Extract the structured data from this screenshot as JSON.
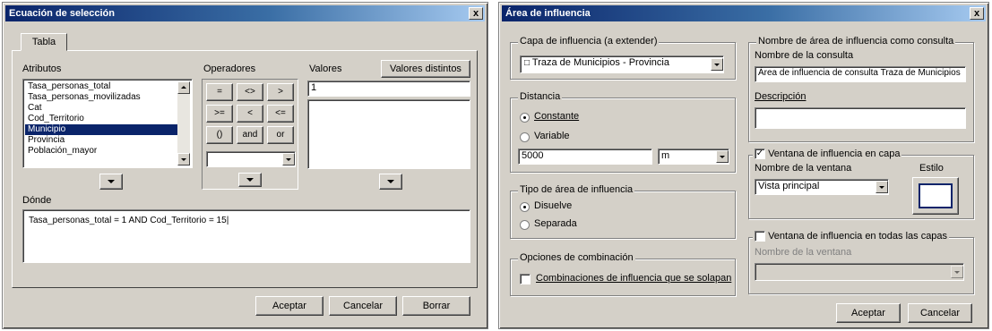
{
  "left_dialog": {
    "title": "Ecuación de selección",
    "close": "x",
    "tab": "Tabla",
    "attributes_label": "Atributos",
    "attributes": [
      "Tasa_personas_total",
      "Tasa_personas_movilizadas",
      "Cat",
      "Cod_Territorio",
      "Municipio",
      "Provincia",
      "Población_mayor"
    ],
    "attributes_selected_index": 4,
    "operators_label": "Operadores",
    "operators": [
      "=",
      "<>",
      ">",
      ">=",
      "<",
      "<=",
      "()",
      "and",
      "or"
    ],
    "values_label": "Valores",
    "values_button": "Valores distintos",
    "values_input": "1",
    "value_items": [],
    "where_label": "Dónde",
    "where_text": "Tasa_personas_total = 1 AND Cod_Territorio = 15",
    "buttons": [
      "Aceptar",
      "Cancelar",
      "Borrar"
    ]
  },
  "right_dialog": {
    "title": "Área de influencia",
    "close": "x",
    "layer_group": "Capa de influencia (a extender)",
    "layer_value": "Traza de Municipios - Provincia",
    "distance_group": "Distancia",
    "distance_options": [
      "Constante",
      "Variable"
    ],
    "distance_selected": 0,
    "distance_value": "5000",
    "distance_unit": "m",
    "region_group": "Tipo de área de influencia",
    "region_options": [
      "Disuelve",
      "Separada"
    ],
    "region_selected": 0,
    "options_group": "Opciones de combinación",
    "options_check": "Combinaciones de influencia que se solapan",
    "query_group": "Nombre de área de influencia como consulta",
    "query_name_label": "Nombre de la consulta",
    "query_name_value": "Área de influencia de consulta Traza de Municipios",
    "description_label": "Descripción",
    "description_value": "",
    "window_check": "Ventana de influencia en capa",
    "window_check_state": "checked",
    "window_name_label": "Nombre de la ventana",
    "window_name_value": "Vista principal",
    "style_label": "Estilo",
    "other_check": "Ventana de influencia en todas las capas",
    "other_name_label": "Nombre de la ventana",
    "other_name_value": "",
    "buttons": [
      "Aceptar",
      "Cancelar"
    ]
  },
  "colors": {
    "titlebar_start": "#0a246a",
    "titlebar_end": "#a6caf0",
    "dialog_bg": "#d4d0c8",
    "selection": "#0a246a"
  }
}
